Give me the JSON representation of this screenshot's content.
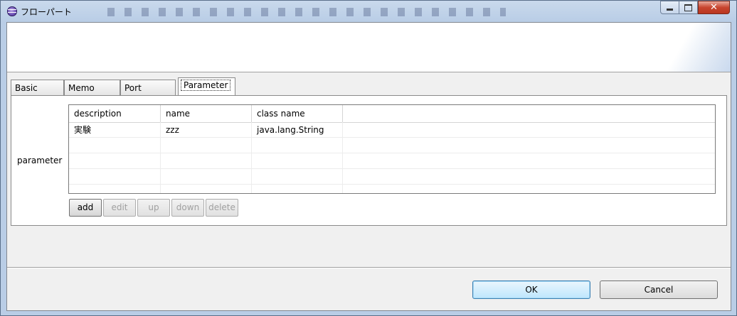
{
  "window": {
    "title": "フローパート"
  },
  "controls": {
    "close_glyph": "✕"
  },
  "tabs": [
    {
      "label": "Basic"
    },
    {
      "label": "Memo"
    },
    {
      "label": "Port"
    },
    {
      "label": "Parameter",
      "active": true
    }
  ],
  "parameter": {
    "label": "parameter",
    "columns": [
      "description",
      "name",
      "class name"
    ],
    "rows": [
      {
        "description": "実験",
        "name": "zzz",
        "class_name": "java.lang.String"
      }
    ],
    "buttons": {
      "add": "add",
      "edit": "edit",
      "up": "up",
      "down": "down",
      "delete": "delete"
    },
    "disabled_buttons": [
      "edit",
      "up",
      "down",
      "delete"
    ]
  },
  "dialog": {
    "ok": "OK",
    "cancel": "Cancel"
  },
  "colors": {
    "ok_border": "#3c7fb1",
    "close_button": "#c8452f"
  }
}
